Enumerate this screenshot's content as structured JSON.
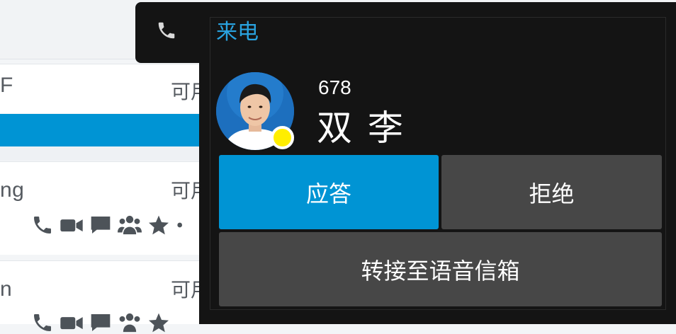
{
  "background_list": {
    "rows": [
      {
        "name_fragment": "F",
        "status": "可用"
      },
      {
        "name_fragment": "ng",
        "status": "可用"
      },
      {
        "name_fragment": "n",
        "status": "可用"
      }
    ],
    "action_icons": [
      "phone-icon",
      "video-icon",
      "chat-icon",
      "group-icon",
      "star-icon",
      "more-icon"
    ]
  },
  "incoming_call": {
    "title": "来电",
    "caller_number": "678",
    "caller_name": "双 李",
    "presence_color": "#ffee00",
    "buttons": {
      "answer": "应答",
      "decline": "拒绝",
      "voicemail": "转接至语音信箱"
    }
  },
  "colors": {
    "accent": "#0094d4",
    "title_blue": "#29a3e0",
    "popup_bg": "#141414",
    "button_gray": "#474747"
  }
}
